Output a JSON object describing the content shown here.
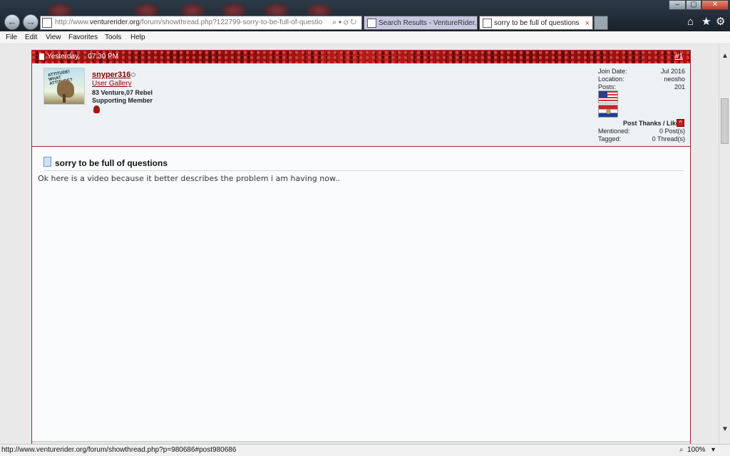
{
  "browser": {
    "address_prefix": "http://www.",
    "address_domain": "venturerider.org",
    "address_rest": "/forum/showthread.php?122799-sorry-to-be-full-of-questio",
    "address_tools": "⌕▾⊘↻",
    "tabs": [
      {
        "label": "Search Results - VentureRider...."
      },
      {
        "label": "sorry to be full of questions",
        "close": "×"
      }
    ],
    "back_icon": "←",
    "forward_icon": "→",
    "home_icon": "⌂",
    "favorites_icon": "★",
    "settings_icon": "⚙",
    "window_min": "–",
    "window_max": "▢",
    "window_close": "✕"
  },
  "menu": [
    "File",
    "Edit",
    "View",
    "Favorites",
    "Tools",
    "Help"
  ],
  "post": {
    "date_day": "Yesterday,",
    "date_time": "07:30 PM",
    "number": "#1",
    "user": {
      "name": "snyper316",
      "gallery_link": "User Gallery",
      "bikes": "83 Venture,07 Rebel",
      "rank": "Supporting Member",
      "avatar_text": "ATTITUDE! WHAT ATTITUDE?"
    },
    "stats": [
      {
        "label": "Join Date:",
        "value": "Jul 2016"
      },
      {
        "label": "Location:",
        "value": "neosho"
      },
      {
        "label": "Posts:",
        "value": "201"
      }
    ],
    "thanks_label": "Post Thanks / Like",
    "thanks_stats": [
      {
        "label": "Mentioned:",
        "value": "0 Post(s)"
      },
      {
        "label": "Tagged:",
        "value": "0 Thread(s)"
      }
    ],
    "title": "sorry to be full of questions",
    "body": "Ok here is a video because it better describes the problem i am having now.."
  },
  "status": {
    "url": "http://www.venturerider.org/forum/showthread.php?p=980686#post980686",
    "zoom": "100%"
  },
  "colors": {
    "header_red": "#b11313",
    "link_red": "#8b0000",
    "post_background": "#fafbfc",
    "userinfo_background": "#eef1f4"
  }
}
